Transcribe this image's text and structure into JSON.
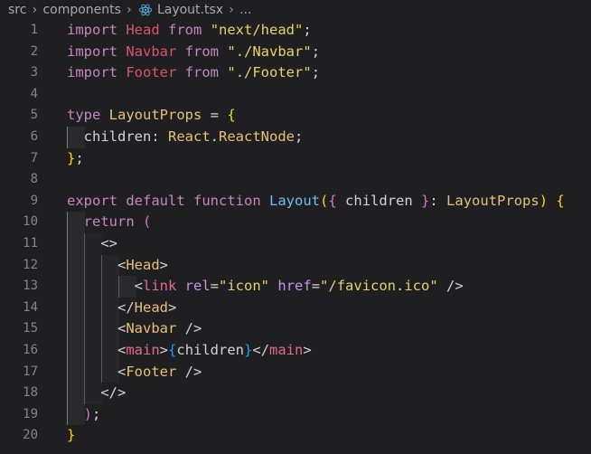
{
  "breadcrumb": {
    "segments": [
      "src",
      "components",
      "Layout.tsx",
      "..."
    ],
    "icon": "react-icon"
  },
  "lines": [
    {
      "n": "1",
      "tokens": [
        [
          "kw",
          "import"
        ],
        [
          "plain",
          " "
        ],
        [
          "ident",
          "Head"
        ],
        [
          "plain",
          " "
        ],
        [
          "kw",
          "from"
        ],
        [
          "plain",
          " "
        ],
        [
          "str",
          "\"next/head\""
        ],
        [
          "plain",
          ";"
        ]
      ]
    },
    {
      "n": "2",
      "tokens": [
        [
          "kw",
          "import"
        ],
        [
          "plain",
          " "
        ],
        [
          "ident",
          "Navbar"
        ],
        [
          "plain",
          " "
        ],
        [
          "kw",
          "from"
        ],
        [
          "plain",
          " "
        ],
        [
          "str",
          "\"./Navbar\""
        ],
        [
          "plain",
          ";"
        ]
      ]
    },
    {
      "n": "3",
      "tokens": [
        [
          "kw",
          "import"
        ],
        [
          "plain",
          " "
        ],
        [
          "ident",
          "Footer"
        ],
        [
          "plain",
          " "
        ],
        [
          "kw",
          "from"
        ],
        [
          "plain",
          " "
        ],
        [
          "str",
          "\"./Footer\""
        ],
        [
          "plain",
          ";"
        ]
      ]
    },
    {
      "n": "4",
      "tokens": []
    },
    {
      "n": "5",
      "tokens": [
        [
          "kw",
          "type"
        ],
        [
          "plain",
          " "
        ],
        [
          "type",
          "LayoutProps"
        ],
        [
          "plain",
          " = "
        ],
        [
          "brace1",
          "{"
        ]
      ]
    },
    {
      "n": "6",
      "guides": 1,
      "tokens": [
        [
          "plain",
          "  "
        ],
        [
          "prop",
          "children"
        ],
        [
          "plain",
          ": "
        ],
        [
          "type",
          "React"
        ],
        [
          "plain",
          "."
        ],
        [
          "type",
          "ReactNode"
        ],
        [
          "plain",
          ";"
        ]
      ]
    },
    {
      "n": "7",
      "tokens": [
        [
          "brace1",
          "}"
        ],
        [
          "plain",
          ";"
        ]
      ]
    },
    {
      "n": "8",
      "tokens": []
    },
    {
      "n": "9",
      "tokens": [
        [
          "kw",
          "export"
        ],
        [
          "plain",
          " "
        ],
        [
          "kw",
          "default"
        ],
        [
          "plain",
          " "
        ],
        [
          "kw",
          "function"
        ],
        [
          "plain",
          " "
        ],
        [
          "fn",
          "Layout"
        ],
        [
          "brace1",
          "("
        ],
        [
          "brace2",
          "{"
        ],
        [
          "plain",
          " children "
        ],
        [
          "brace2",
          "}"
        ],
        [
          "plain",
          ": "
        ],
        [
          "type",
          "LayoutProps"
        ],
        [
          "brace1",
          ")"
        ],
        [
          "plain",
          " "
        ],
        [
          "brace1",
          "{"
        ]
      ]
    },
    {
      "n": "10",
      "guides": 1,
      "tokens": [
        [
          "plain",
          "  "
        ],
        [
          "kw",
          "return"
        ],
        [
          "plain",
          " "
        ],
        [
          "brace2",
          "("
        ]
      ]
    },
    {
      "n": "11",
      "guides": 2,
      "tokens": [
        [
          "plain",
          "    "
        ],
        [
          "plain",
          "<>"
        ]
      ]
    },
    {
      "n": "12",
      "guides": 3,
      "tokens": [
        [
          "plain",
          "      "
        ],
        [
          "plain",
          "<"
        ],
        [
          "type",
          "Head"
        ],
        [
          "plain",
          ">"
        ]
      ]
    },
    {
      "n": "13",
      "guides": 4,
      "tokens": [
        [
          "plain",
          "        "
        ],
        [
          "plain",
          "<"
        ],
        [
          "tag",
          "link"
        ],
        [
          "plain",
          " "
        ],
        [
          "attr",
          "rel"
        ],
        [
          "plain",
          "="
        ],
        [
          "str",
          "\"icon\""
        ],
        [
          "plain",
          " "
        ],
        [
          "attr",
          "href"
        ],
        [
          "plain",
          "="
        ],
        [
          "str",
          "\"/favicon.ico\""
        ],
        [
          "plain",
          " />"
        ]
      ]
    },
    {
      "n": "14",
      "guides": 3,
      "tokens": [
        [
          "plain",
          "      "
        ],
        [
          "plain",
          "</"
        ],
        [
          "type",
          "Head"
        ],
        [
          "plain",
          ">"
        ]
      ]
    },
    {
      "n": "15",
      "guides": 3,
      "tokens": [
        [
          "plain",
          "      "
        ],
        [
          "plain",
          "<"
        ],
        [
          "type",
          "Navbar"
        ],
        [
          "plain",
          " />"
        ]
      ]
    },
    {
      "n": "16",
      "guides": 3,
      "tokens": [
        [
          "plain",
          "      "
        ],
        [
          "plain",
          "<"
        ],
        [
          "tag",
          "main"
        ],
        [
          "plain",
          ">"
        ],
        [
          "brace3",
          "{"
        ],
        [
          "plain",
          "children"
        ],
        [
          "brace3",
          "}"
        ],
        [
          "plain",
          "</"
        ],
        [
          "tag",
          "main"
        ],
        [
          "plain",
          ">"
        ]
      ]
    },
    {
      "n": "17",
      "guides": 3,
      "tokens": [
        [
          "plain",
          "      "
        ],
        [
          "plain",
          "<"
        ],
        [
          "type",
          "Footer"
        ],
        [
          "plain",
          " />"
        ]
      ]
    },
    {
      "n": "18",
      "guides": 2,
      "tokens": [
        [
          "plain",
          "    "
        ],
        [
          "plain",
          "</>"
        ]
      ]
    },
    {
      "n": "19",
      "guides": 1,
      "tokens": [
        [
          "plain",
          "  "
        ],
        [
          "brace2",
          ")"
        ],
        [
          "plain",
          ";"
        ]
      ]
    },
    {
      "n": "20",
      "tokens": [
        [
          "brace1",
          "}"
        ]
      ]
    }
  ]
}
